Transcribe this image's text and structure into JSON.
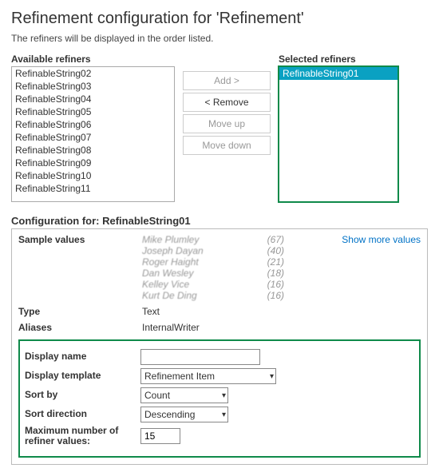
{
  "title": "Refinement configuration for 'Refinement'",
  "subtitle": "The refiners will be displayed in the order listed.",
  "available_label": "Available refiners",
  "selected_label": "Selected refiners",
  "available_items": [
    "RefinableString02",
    "RefinableString03",
    "RefinableString04",
    "RefinableString05",
    "RefinableString06",
    "RefinableString07",
    "RefinableString08",
    "RefinableString09",
    "RefinableString10",
    "RefinableString11"
  ],
  "selected_items": [
    "RefinableString01"
  ],
  "buttons": {
    "add": "Add >",
    "remove": "< Remove",
    "moveup": "Move up",
    "movedown": "Move down"
  },
  "config_for_label": "Configuration for: RefinableString01",
  "sample_values_label": "Sample values",
  "sample_values": [
    {
      "name": "Mike Plumley",
      "count": "(67)"
    },
    {
      "name": "Joseph Dayan",
      "count": "(40)"
    },
    {
      "name": "Roger Haight",
      "count": "(21)"
    },
    {
      "name": "Dan Wesley",
      "count": "(18)"
    },
    {
      "name": "Kelley Vice",
      "count": "(16)"
    },
    {
      "name": "Kurt De Ding",
      "count": "(16)"
    }
  ],
  "show_more": "Show more values",
  "type_label": "Type",
  "type_value": "Text",
  "aliases_label": "Aliases",
  "aliases_value": "InternalWriter",
  "form": {
    "display_name_label": "Display name",
    "display_name_value": "",
    "display_template_label": "Display template",
    "display_template_value": "Refinement Item",
    "sort_by_label": "Sort by",
    "sort_by_value": "Count",
    "sort_direction_label": "Sort direction",
    "sort_direction_value": "Descending",
    "max_label": "Maximum number of refiner values:",
    "max_value": "15"
  }
}
